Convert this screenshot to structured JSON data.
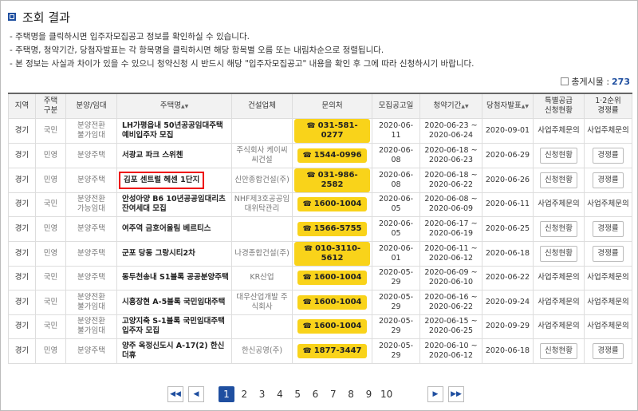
{
  "title": "조회 결과",
  "notes": [
    "- 주택명을 클릭하시면 입주자모집공고 정보를 확인하실 수 있습니다.",
    "- 주택명, 청약기간, 당첨자발표는 각 항목명을 클릭하시면 해당 항목별 오름 또는 내림차순으로 정렬됩니다.",
    "- 본 정보는 사실과 차이가 있을 수 있으니 청약신청 시 반드시 해당 \"입주자모집공고\" 내용을 확인 후 그에 따라 신청하시기 바랍니다."
  ],
  "total": {
    "label": "총게시물 :",
    "count": "273"
  },
  "columns": {
    "region": "지역",
    "house_type": "주택\n구분",
    "supply_type": "분양/임대",
    "house_name": "주택명",
    "builder": "건설업체",
    "contact": "문의처",
    "announce_date": "모집공고일",
    "apply_period": "청약기간",
    "winner_date": "당첨자발표",
    "special": "특별공급\n신청현황",
    "rank": "1·2순위\n경쟁률"
  },
  "sort_mark": "▲▼",
  "phone_icon": "☎",
  "rows": [
    {
      "region": "경기",
      "house_type": "국민",
      "supply_type": "분양전환\n불가임대",
      "house_name": "LH가평읍내 50년공공임대주택\n예비입주자 모집",
      "builder": "",
      "contact": "031-581-0277",
      "announce_date": "2020-06-11",
      "apply_period": "2020-06-23 ~\n2020-06-24",
      "winner_date": "2020-09-01",
      "special": "사업주체문의",
      "rank": "사업주체문의",
      "special_btn": false,
      "rank_btn": false,
      "highlight": false
    },
    {
      "region": "경기",
      "house_type": "민영",
      "supply_type": "분양주택",
      "house_name": "서광교 파크 스위첸",
      "builder": "주식회사 케이씨\n씨건설",
      "contact": "1544-0996",
      "announce_date": "2020-06-08",
      "apply_period": "2020-06-18 ~\n2020-06-23",
      "winner_date": "2020-06-29",
      "special": "신청현황",
      "rank": "경쟁률",
      "special_btn": true,
      "rank_btn": true,
      "highlight": false
    },
    {
      "region": "경기",
      "house_type": "민영",
      "supply_type": "분양주택",
      "house_name": "김포 센트럴 헤센 1단지",
      "builder": "신안종합건설(주)",
      "contact": "031-986-2582",
      "announce_date": "2020-06-08",
      "apply_period": "2020-06-18 ~\n2020-06-22",
      "winner_date": "2020-06-26",
      "special": "신청현황",
      "rank": "경쟁률",
      "special_btn": true,
      "rank_btn": true,
      "highlight": true
    },
    {
      "region": "경기",
      "house_type": "국민",
      "supply_type": "분양전환\n가능임대",
      "house_name": "안성아양 B6 10년공공임대리츠\n잔여세대 모집",
      "builder": "NHF제3호공공임\n대위탁관리",
      "contact": "1600-1004",
      "announce_date": "2020-06-05",
      "apply_period": "2020-06-08 ~\n2020-06-09",
      "winner_date": "2020-06-11",
      "special": "사업주체문의",
      "rank": "사업주체문의",
      "special_btn": false,
      "rank_btn": false,
      "highlight": false
    },
    {
      "region": "경기",
      "house_type": "민영",
      "supply_type": "분양주택",
      "house_name": "여주역 금호어울림 베르티스",
      "builder": "",
      "contact": "1566-5755",
      "announce_date": "2020-06-05",
      "apply_period": "2020-06-17 ~\n2020-06-19",
      "winner_date": "2020-06-25",
      "special": "신청현황",
      "rank": "경쟁률",
      "special_btn": true,
      "rank_btn": true,
      "highlight": false
    },
    {
      "region": "경기",
      "house_type": "민영",
      "supply_type": "분양주택",
      "house_name": "군포 당동 그랑시티2차",
      "builder": "나경종합건설(주)",
      "contact": "010-3110-5612",
      "announce_date": "2020-06-01",
      "apply_period": "2020-06-11 ~\n2020-06-12",
      "winner_date": "2020-06-18",
      "special": "신청현황",
      "rank": "경쟁률",
      "special_btn": true,
      "rank_btn": true,
      "highlight": false
    },
    {
      "region": "경기",
      "house_type": "국민",
      "supply_type": "분양주택",
      "house_name": "동두천송내 S1블록 공공분양주택",
      "builder": "KR산업",
      "contact": "1600-1004",
      "announce_date": "2020-05-29",
      "apply_period": "2020-06-09 ~\n2020-06-10",
      "winner_date": "2020-06-22",
      "special": "사업주체문의",
      "rank": "사업주체문의",
      "special_btn": false,
      "rank_btn": false,
      "highlight": false
    },
    {
      "region": "경기",
      "house_type": "국민",
      "supply_type": "분양전환\n불가임대",
      "house_name": "시흥장현 A-5블록 국민임대주택",
      "builder": "대우산업개발 주\n식회사",
      "contact": "1600-1004",
      "announce_date": "2020-05-29",
      "apply_period": "2020-06-16 ~\n2020-06-22",
      "winner_date": "2020-09-24",
      "special": "사업주체문의",
      "rank": "사업주체문의",
      "special_btn": false,
      "rank_btn": false,
      "highlight": false
    },
    {
      "region": "경기",
      "house_type": "국민",
      "supply_type": "분양전환\n불가임대",
      "house_name": "고양지축 S-1블록 국민임대주택\n입주자 모집",
      "builder": "",
      "contact": "1600-1004",
      "announce_date": "2020-05-29",
      "apply_period": "2020-06-15 ~\n2020-06-25",
      "winner_date": "2020-09-29",
      "special": "사업주체문의",
      "rank": "사업주체문의",
      "special_btn": false,
      "rank_btn": false,
      "highlight": false
    },
    {
      "region": "경기",
      "house_type": "민영",
      "supply_type": "분양주택",
      "house_name": "양주 옥정신도시 A-17(2) 한신더휴",
      "builder": "한신공영(주)",
      "contact": "1877-3447",
      "announce_date": "2020-05-29",
      "apply_period": "2020-06-10 ~\n2020-06-12",
      "winner_date": "2020-06-18",
      "special": "신청현황",
      "rank": "경쟁률",
      "special_btn": true,
      "rank_btn": true,
      "highlight": false
    }
  ],
  "pager": {
    "first": "◀◀",
    "prev": "◀",
    "next": "▶",
    "last": "▶▶",
    "pages": [
      "1",
      "2",
      "3",
      "4",
      "5",
      "6",
      "7",
      "8",
      "9",
      "10"
    ],
    "current": "1"
  }
}
